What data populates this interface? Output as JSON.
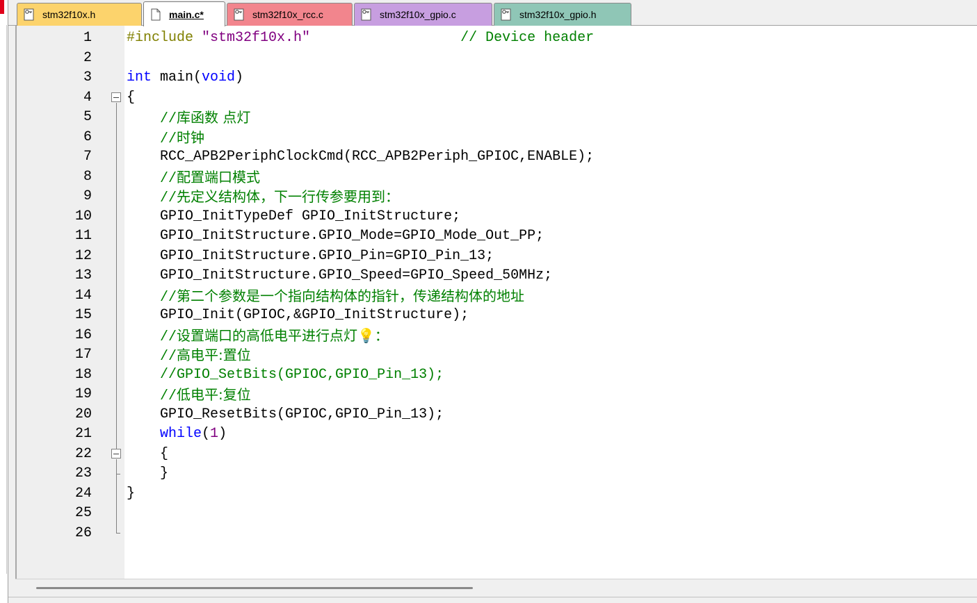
{
  "colors": {
    "tab_h": "#fcd36c",
    "tab_main": "#ffffff",
    "tab_rcc": "#f2858d",
    "tab_gpio_c": "#c79ee0",
    "tab_gpio_h": "#8fc6b6",
    "keyword": "#0000ff",
    "preprocessor": "#808000",
    "string": "#800080",
    "comment": "#008000"
  },
  "tabs": [
    {
      "label": "stm32f10x.h",
      "icon": "header-file-icon",
      "active": false
    },
    {
      "label": "main.c*",
      "icon": "c-file-icon",
      "active": true
    },
    {
      "label": "stm32f10x_rcc.c",
      "icon": "c-file-icon",
      "active": false
    },
    {
      "label": "stm32f10x_gpio.c",
      "icon": "c-file-icon",
      "active": false
    },
    {
      "label": "stm32f10x_gpio.h",
      "icon": "header-file-icon",
      "active": false
    }
  ],
  "lines": [
    {
      "n": "1",
      "tokens": [
        {
          "t": "#include ",
          "c": "pp"
        },
        {
          "t": "\"stm32f10x.h\"",
          "c": "str"
        },
        {
          "t": "                  ",
          "c": ""
        },
        {
          "t": "// Device header",
          "c": "cm"
        }
      ]
    },
    {
      "n": "2",
      "tokens": []
    },
    {
      "n": "3",
      "tokens": [
        {
          "t": "int",
          "c": "kw"
        },
        {
          "t": " main(",
          "c": ""
        },
        {
          "t": "void",
          "c": "kw"
        },
        {
          "t": ")",
          "c": ""
        }
      ]
    },
    {
      "n": "4",
      "tokens": [
        {
          "t": "{",
          "c": ""
        }
      ]
    },
    {
      "n": "5",
      "tokens": [
        {
          "t": "    ",
          "c": ""
        },
        {
          "t": "//",
          "c": "cm"
        },
        {
          "t": "库函数 点灯",
          "c": "cmz"
        }
      ]
    },
    {
      "n": "6",
      "tokens": [
        {
          "t": "    ",
          "c": ""
        },
        {
          "t": "//",
          "c": "cm"
        },
        {
          "t": "时钟",
          "c": "cmz"
        }
      ]
    },
    {
      "n": "7",
      "tokens": [
        {
          "t": "    RCC_APB2PeriphClockCmd(RCC_APB2Periph_GPIOC,ENABLE);",
          "c": ""
        }
      ]
    },
    {
      "n": "8",
      "tokens": [
        {
          "t": "    ",
          "c": ""
        },
        {
          "t": "//",
          "c": "cm"
        },
        {
          "t": "配置端口模式",
          "c": "cmz"
        }
      ]
    },
    {
      "n": "9",
      "tokens": [
        {
          "t": "    ",
          "c": ""
        },
        {
          "t": "//",
          "c": "cm"
        },
        {
          "t": "先定义结构体，下一行传参要用到：",
          "c": "cmz"
        }
      ]
    },
    {
      "n": "10",
      "tokens": [
        {
          "t": "    GPIO_InitTypeDef GPIO_InitStructure;",
          "c": ""
        }
      ]
    },
    {
      "n": "11",
      "tokens": [
        {
          "t": "    GPIO_InitStructure.GPIO_Mode=GPIO_Mode_Out_PP;",
          "c": ""
        }
      ]
    },
    {
      "n": "12",
      "tokens": [
        {
          "t": "    GPIO_InitStructure.GPIO_Pin=GPIO_Pin_13;",
          "c": ""
        }
      ]
    },
    {
      "n": "13",
      "tokens": [
        {
          "t": "    GPIO_InitStructure.GPIO_Speed=GPIO_Speed_50MHz;",
          "c": ""
        }
      ]
    },
    {
      "n": "14",
      "tokens": [
        {
          "t": "    ",
          "c": ""
        },
        {
          "t": "//",
          "c": "cm"
        },
        {
          "t": "第二个参数是一个指向结构体的指针，传递结构体的地址",
          "c": "cmz"
        }
      ]
    },
    {
      "n": "15",
      "tokens": [
        {
          "t": "    GPIO_Init(GPIOC,&GPIO_InitStructure);",
          "c": ""
        }
      ]
    },
    {
      "n": "16",
      "tokens": [
        {
          "t": "    ",
          "c": ""
        },
        {
          "t": "//",
          "c": "cm"
        },
        {
          "t": "设置端口的高低电平进行点灯💡：",
          "c": "cmz"
        }
      ]
    },
    {
      "n": "17",
      "tokens": [
        {
          "t": "    ",
          "c": ""
        },
        {
          "t": "//",
          "c": "cm"
        },
        {
          "t": "高电平:置位",
          "c": "cmz"
        }
      ]
    },
    {
      "n": "18",
      "tokens": [
        {
          "t": "    ",
          "c": ""
        },
        {
          "t": "//GPIO_SetBits(GPIOC,GPIO_Pin_13);",
          "c": "cm"
        }
      ]
    },
    {
      "n": "19",
      "tokens": [
        {
          "t": "    ",
          "c": ""
        },
        {
          "t": "//",
          "c": "cm"
        },
        {
          "t": "低电平:复位",
          "c": "cmz"
        }
      ]
    },
    {
      "n": "20",
      "tokens": [
        {
          "t": "    GPIO_ResetBits(GPIOC,GPIO_Pin_13);",
          "c": ""
        }
      ]
    },
    {
      "n": "21",
      "tokens": [
        {
          "t": "    ",
          "c": ""
        },
        {
          "t": "while",
          "c": "kw"
        },
        {
          "t": "(",
          "c": ""
        },
        {
          "t": "1",
          "c": "num"
        },
        {
          "t": ")",
          "c": ""
        }
      ]
    },
    {
      "n": "22",
      "tokens": [
        {
          "t": "    {",
          "c": ""
        }
      ]
    },
    {
      "n": "23",
      "tokens": [
        {
          "t": "    }",
          "c": ""
        }
      ]
    },
    {
      "n": "24",
      "tokens": [
        {
          "t": "}",
          "c": ""
        }
      ]
    },
    {
      "n": "25",
      "tokens": []
    },
    {
      "n": "26",
      "tokens": []
    }
  ]
}
